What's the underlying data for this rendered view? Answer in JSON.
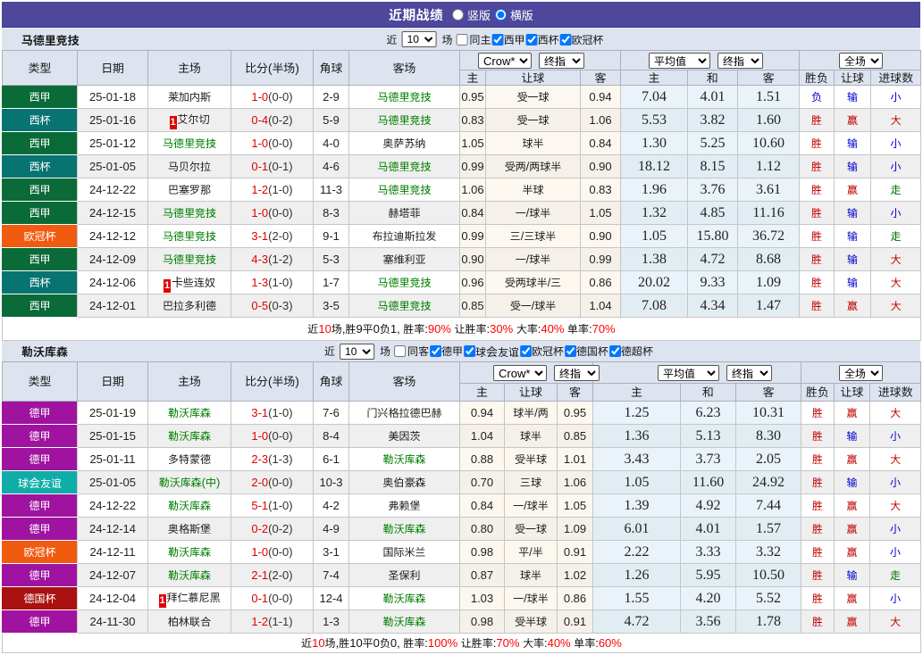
{
  "topbar": {
    "title": "近期战绩",
    "layout_options": [
      {
        "label": "竖版",
        "checked": false
      },
      {
        "label": "横版",
        "checked": true
      }
    ]
  },
  "column_headers": {
    "type": "类型",
    "date": "日期",
    "home": "主场",
    "score": "比分(半场)",
    "corner": "角球",
    "away": "客场",
    "odds_home": "主",
    "odds_handicap": "让球",
    "odds_away": "客",
    "avg_home": "主",
    "avg_draw": "和",
    "avg_away": "客",
    "result_wl": "胜负",
    "result_handicap": "让球",
    "result_goals": "进球数"
  },
  "colors": {
    "type_badges": {
      "西甲": "#0a6b38",
      "西杯": "#077471",
      "欧冠杯": "#f05b10",
      "德甲": "#a013a0",
      "球会友谊": "#10ada8",
      "德国杯": "#aa1111"
    },
    "topbar_bg": "#4e479c",
    "focus_team": "#008000",
    "score_red": "#e00000",
    "result_red": "#c00000",
    "result_blue": "#0000cc",
    "result_green": "#007000",
    "summary_red": "#ff0000"
  },
  "sections": [
    {
      "team": "马德里竞技",
      "filter": {
        "prefix": "近",
        "count": "10",
        "suffix": "场",
        "same": {
          "label": "同主",
          "checked": false
        },
        "comps": [
          {
            "label": "西甲",
            "checked": true
          },
          {
            "label": "西杯",
            "checked": true
          },
          {
            "label": "欧冠杯",
            "checked": true
          }
        ]
      },
      "selects": {
        "book": "Crow*",
        "book_time": "终指",
        "avg": "平均值",
        "avg_time": "终指",
        "scope": "全场"
      },
      "rows": [
        {
          "type": "西甲",
          "date": "25-01-18",
          "home": "莱加内斯",
          "hf": 0,
          "hr": 0,
          "ft": "1-0",
          "ht": "(0-0)",
          "corner": "2-9",
          "away": "马德里竞技",
          "af": 1,
          "ar": 0,
          "odds": [
            "0.95",
            "受一球",
            "0.94"
          ],
          "avg": [
            "7.04",
            "4.01",
            "1.51"
          ],
          "res": [
            "负",
            "输",
            "小"
          ],
          "rc": [
            "b",
            "b",
            "b"
          ]
        },
        {
          "type": "西杯",
          "date": "25-01-16",
          "home": "艾尔切",
          "hf": 0,
          "hr": 1,
          "ft": "0-4",
          "ht": "(0-2)",
          "corner": "5-9",
          "away": "马德里竞技",
          "af": 1,
          "ar": 0,
          "odds": [
            "0.83",
            "受一球",
            "1.06"
          ],
          "avg": [
            "5.53",
            "3.82",
            "1.60"
          ],
          "res": [
            "胜",
            "赢",
            "大"
          ],
          "rc": [
            "r",
            "r",
            "r"
          ]
        },
        {
          "type": "西甲",
          "date": "25-01-12",
          "home": "马德里竞技",
          "hf": 1,
          "hr": 0,
          "ft": "1-0",
          "ht": "(0-0)",
          "corner": "4-0",
          "away": "奥萨苏纳",
          "af": 0,
          "ar": 0,
          "odds": [
            "1.05",
            "球半",
            "0.84"
          ],
          "avg": [
            "1.30",
            "5.25",
            "10.60"
          ],
          "res": [
            "胜",
            "输",
            "小"
          ],
          "rc": [
            "r",
            "b",
            "b"
          ]
        },
        {
          "type": "西杯",
          "date": "25-01-05",
          "home": "马贝尔拉",
          "hf": 0,
          "hr": 0,
          "ft": "0-1",
          "ht": "(0-1)",
          "corner": "4-6",
          "away": "马德里竞技",
          "af": 1,
          "ar": 0,
          "odds": [
            "0.99",
            "受两/两球半",
            "0.90"
          ],
          "avg": [
            "18.12",
            "8.15",
            "1.12"
          ],
          "res": [
            "胜",
            "输",
            "小"
          ],
          "rc": [
            "r",
            "b",
            "b"
          ]
        },
        {
          "type": "西甲",
          "date": "24-12-22",
          "home": "巴塞罗那",
          "hf": 0,
          "hr": 0,
          "ft": "1-2",
          "ht": "(1-0)",
          "corner": "11-3",
          "away": "马德里竞技",
          "af": 1,
          "ar": 0,
          "odds": [
            "1.06",
            "半球",
            "0.83"
          ],
          "avg": [
            "1.96",
            "3.76",
            "3.61"
          ],
          "res": [
            "胜",
            "赢",
            "走"
          ],
          "rc": [
            "r",
            "r",
            "g"
          ]
        },
        {
          "type": "西甲",
          "date": "24-12-15",
          "home": "马德里竞技",
          "hf": 1,
          "hr": 0,
          "ft": "1-0",
          "ht": "(0-0)",
          "corner": "8-3",
          "away": "赫塔菲",
          "af": 0,
          "ar": 0,
          "odds": [
            "0.84",
            "一/球半",
            "1.05"
          ],
          "avg": [
            "1.32",
            "4.85",
            "11.16"
          ],
          "res": [
            "胜",
            "输",
            "小"
          ],
          "rc": [
            "r",
            "b",
            "b"
          ]
        },
        {
          "type": "欧冠杯",
          "date": "24-12-12",
          "home": "马德里竞技",
          "hf": 1,
          "hr": 0,
          "ft": "3-1",
          "ht": "(2-0)",
          "corner": "9-1",
          "away": "布拉迪斯拉发",
          "af": 0,
          "ar": 0,
          "odds": [
            "0.99",
            "三/三球半",
            "0.90"
          ],
          "avg": [
            "1.05",
            "15.80",
            "36.72"
          ],
          "res": [
            "胜",
            "输",
            "走"
          ],
          "rc": [
            "r",
            "b",
            "g"
          ]
        },
        {
          "type": "西甲",
          "date": "24-12-09",
          "home": "马德里竞技",
          "hf": 1,
          "hr": 0,
          "ft": "4-3",
          "ht": "(1-2)",
          "corner": "5-3",
          "away": "塞维利亚",
          "af": 0,
          "ar": 0,
          "odds": [
            "0.90",
            "一/球半",
            "0.99"
          ],
          "avg": [
            "1.38",
            "4.72",
            "8.68"
          ],
          "res": [
            "胜",
            "输",
            "大"
          ],
          "rc": [
            "r",
            "b",
            "r"
          ]
        },
        {
          "type": "西杯",
          "date": "24-12-06",
          "home": "卡些连奴",
          "hf": 0,
          "hr": 1,
          "ft": "1-3",
          "ht": "(1-0)",
          "corner": "1-7",
          "away": "马德里竞技",
          "af": 1,
          "ar": 0,
          "odds": [
            "0.96",
            "受两球半/三",
            "0.86"
          ],
          "avg": [
            "20.02",
            "9.33",
            "1.09"
          ],
          "res": [
            "胜",
            "输",
            "大"
          ],
          "rc": [
            "r",
            "b",
            "r"
          ]
        },
        {
          "type": "西甲",
          "date": "24-12-01",
          "home": "巴拉多利德",
          "hf": 0,
          "hr": 0,
          "ft": "0-5",
          "ht": "(0-3)",
          "corner": "3-5",
          "away": "马德里竞技",
          "af": 1,
          "ar": 0,
          "odds": [
            "0.85",
            "受一/球半",
            "1.04"
          ],
          "avg": [
            "7.08",
            "4.34",
            "1.47"
          ],
          "res": [
            "胜",
            "赢",
            "大"
          ],
          "rc": [
            "r",
            "r",
            "r"
          ]
        }
      ],
      "summary": [
        {
          "t": "近",
          "c": "k"
        },
        {
          "t": "10",
          "c": "r"
        },
        {
          "t": "场,胜9平0负1, 胜率:",
          "c": "k"
        },
        {
          "t": "90%",
          "c": "r"
        },
        {
          "t": " 让胜率:",
          "c": "k"
        },
        {
          "t": "30%",
          "c": "r"
        },
        {
          "t": " 大率:",
          "c": "k"
        },
        {
          "t": "40%",
          "c": "r"
        },
        {
          "t": " 单率:",
          "c": "k"
        },
        {
          "t": "70%",
          "c": "r"
        }
      ]
    },
    {
      "team": "勒沃库森",
      "filter": {
        "prefix": "近",
        "count": "10",
        "suffix": "场",
        "same": {
          "label": "同客",
          "checked": false
        },
        "comps": [
          {
            "label": "德甲",
            "checked": true
          },
          {
            "label": "球会友谊",
            "checked": true
          },
          {
            "label": "欧冠杯",
            "checked": true
          },
          {
            "label": "德国杯",
            "checked": true
          },
          {
            "label": "德超杯",
            "checked": true
          }
        ]
      },
      "selects": {
        "book": "Crow*",
        "book_time": "终指",
        "avg": "平均值",
        "avg_time": "终指",
        "scope": "全场"
      },
      "rows": [
        {
          "type": "德甲",
          "date": "25-01-19",
          "home": "勒沃库森",
          "hf": 1,
          "hr": 0,
          "ft": "3-1",
          "ht": "(1-0)",
          "corner": "7-6",
          "away": "门兴格拉德巴赫",
          "af": 0,
          "ar": 0,
          "odds": [
            "0.94",
            "球半/两",
            "0.95"
          ],
          "avg": [
            "1.25",
            "6.23",
            "10.31"
          ],
          "res": [
            "胜",
            "赢",
            "大"
          ],
          "rc": [
            "r",
            "r",
            "r"
          ]
        },
        {
          "type": "德甲",
          "date": "25-01-15",
          "home": "勒沃库森",
          "hf": 1,
          "hr": 0,
          "ft": "1-0",
          "ht": "(0-0)",
          "corner": "8-4",
          "away": "美因茨",
          "af": 0,
          "ar": 0,
          "odds": [
            "1.04",
            "球半",
            "0.85"
          ],
          "avg": [
            "1.36",
            "5.13",
            "8.30"
          ],
          "res": [
            "胜",
            "输",
            "小"
          ],
          "rc": [
            "r",
            "b",
            "b"
          ]
        },
        {
          "type": "德甲",
          "date": "25-01-11",
          "home": "多特蒙德",
          "hf": 0,
          "hr": 0,
          "ft": "2-3",
          "ht": "(1-3)",
          "corner": "6-1",
          "away": "勒沃库森",
          "af": 1,
          "ar": 0,
          "odds": [
            "0.88",
            "受半球",
            "1.01"
          ],
          "avg": [
            "3.43",
            "3.73",
            "2.05"
          ],
          "res": [
            "胜",
            "赢",
            "大"
          ],
          "rc": [
            "r",
            "r",
            "r"
          ]
        },
        {
          "type": "球会友谊",
          "date": "25-01-05",
          "home": "勒沃库森(中)",
          "hf": 1,
          "hr": 0,
          "ft": "2-0",
          "ht": "(0-0)",
          "corner": "10-3",
          "away": "奥伯豪森",
          "af": 0,
          "ar": 0,
          "odds": [
            "0.70",
            "三球",
            "1.06"
          ],
          "avg": [
            "1.05",
            "11.60",
            "24.92"
          ],
          "res": [
            "胜",
            "输",
            "小"
          ],
          "rc": [
            "r",
            "b",
            "b"
          ]
        },
        {
          "type": "德甲",
          "date": "24-12-22",
          "home": "勒沃库森",
          "hf": 1,
          "hr": 0,
          "ft": "5-1",
          "ht": "(1-0)",
          "corner": "4-2",
          "away": "弗赖堡",
          "af": 0,
          "ar": 0,
          "odds": [
            "0.84",
            "一/球半",
            "1.05"
          ],
          "avg": [
            "1.39",
            "4.92",
            "7.44"
          ],
          "res": [
            "胜",
            "赢",
            "大"
          ],
          "rc": [
            "r",
            "r",
            "r"
          ]
        },
        {
          "type": "德甲",
          "date": "24-12-14",
          "home": "奥格斯堡",
          "hf": 0,
          "hr": 0,
          "ft": "0-2",
          "ht": "(0-2)",
          "corner": "4-9",
          "away": "勒沃库森",
          "af": 1,
          "ar": 0,
          "odds": [
            "0.80",
            "受一球",
            "1.09"
          ],
          "avg": [
            "6.01",
            "4.01",
            "1.57"
          ],
          "res": [
            "胜",
            "赢",
            "小"
          ],
          "rc": [
            "r",
            "r",
            "b"
          ]
        },
        {
          "type": "欧冠杯",
          "date": "24-12-11",
          "home": "勒沃库森",
          "hf": 1,
          "hr": 0,
          "ft": "1-0",
          "ht": "(0-0)",
          "corner": "3-1",
          "away": "国际米兰",
          "af": 0,
          "ar": 0,
          "odds": [
            "0.98",
            "平/半",
            "0.91"
          ],
          "avg": [
            "2.22",
            "3.33",
            "3.32"
          ],
          "res": [
            "胜",
            "赢",
            "小"
          ],
          "rc": [
            "r",
            "r",
            "b"
          ]
        },
        {
          "type": "德甲",
          "date": "24-12-07",
          "home": "勒沃库森",
          "hf": 1,
          "hr": 0,
          "ft": "2-1",
          "ht": "(2-0)",
          "corner": "7-4",
          "away": "圣保利",
          "af": 0,
          "ar": 0,
          "odds": [
            "0.87",
            "球半",
            "1.02"
          ],
          "avg": [
            "1.26",
            "5.95",
            "10.50"
          ],
          "res": [
            "胜",
            "输",
            "走"
          ],
          "rc": [
            "r",
            "b",
            "g"
          ]
        },
        {
          "type": "德国杯",
          "date": "24-12-04",
          "home": "拜仁慕尼黑",
          "hf": 0,
          "hr": 1,
          "ft": "0-1",
          "ht": "(0-0)",
          "corner": "12-4",
          "away": "勒沃库森",
          "af": 1,
          "ar": 0,
          "odds": [
            "1.03",
            "一/球半",
            "0.86"
          ],
          "avg": [
            "1.55",
            "4.20",
            "5.52"
          ],
          "res": [
            "胜",
            "赢",
            "小"
          ],
          "rc": [
            "r",
            "r",
            "b"
          ]
        },
        {
          "type": "德甲",
          "date": "24-11-30",
          "home": "柏林联合",
          "hf": 0,
          "hr": 0,
          "ft": "1-2",
          "ht": "(1-1)",
          "corner": "1-3",
          "away": "勒沃库森",
          "af": 1,
          "ar": 0,
          "odds": [
            "0.98",
            "受半球",
            "0.91"
          ],
          "avg": [
            "4.72",
            "3.56",
            "1.78"
          ],
          "res": [
            "胜",
            "赢",
            "大"
          ],
          "rc": [
            "r",
            "r",
            "r"
          ]
        }
      ],
      "summary": [
        {
          "t": "近",
          "c": "k"
        },
        {
          "t": "10",
          "c": "r"
        },
        {
          "t": "场,胜10平0负0, 胜率:",
          "c": "k"
        },
        {
          "t": "100%",
          "c": "r"
        },
        {
          "t": " 让胜率:",
          "c": "k"
        },
        {
          "t": "70%",
          "c": "r"
        },
        {
          "t": " 大率:",
          "c": "k"
        },
        {
          "t": "40%",
          "c": "r"
        },
        {
          "t": " 单率:",
          "c": "k"
        },
        {
          "t": "60%",
          "c": "r"
        }
      ]
    }
  ]
}
